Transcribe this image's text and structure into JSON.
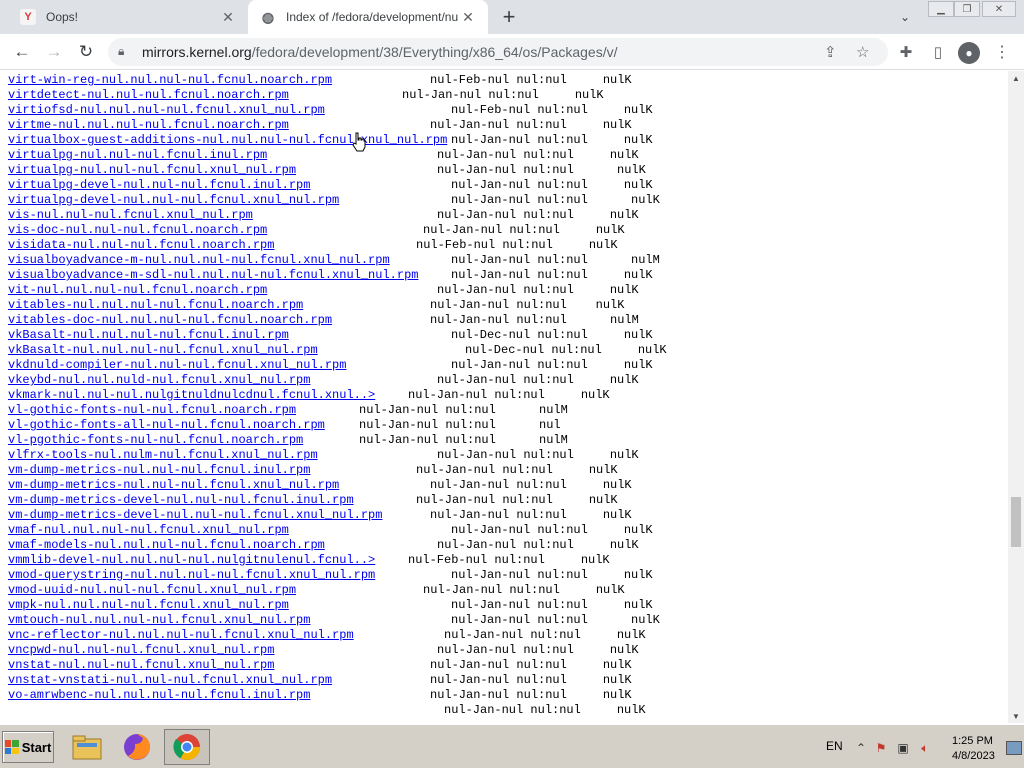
{
  "tabs": [
    {
      "title": "Oops!",
      "favicon": "Y"
    },
    {
      "title": "Index of /fedora/development/nul/E",
      "favicon": "globe-icon"
    }
  ],
  "toolbar": {
    "url_host": "mirrors.kernel.org",
    "url_path": "/fedora/development/38/Everything/x86_64/os/Packages/v/"
  },
  "listing": [
    {
      "name": "virt-win-reg-nul.nul.nul-nul.fcnul.noarch.rpm",
      "meta": "nul-Feb-nul nul:nul     nulK",
      "col": 430
    },
    {
      "name": "virtdetect-nul.nul-nul.fcnul.noarch.rpm",
      "meta": "nul-Jan-nul nul:nul     nulK",
      "col": 402
    },
    {
      "name": "virtiofsd-nul.nul.nul-nul.fcnul.xnul_nul.rpm",
      "meta": "nul-Feb-nul nul:nul     nulK",
      "col": 451
    },
    {
      "name": "virtme-nul.nul.nul-nul.fcnul.noarch.rpm",
      "meta": "nul-Jan-nul nul:nul     nulK",
      "col": 430
    },
    {
      "name": "virtualbox-guest-additions-nul.nul.nul-nul.fcnul.xnul_nul.rpm",
      "meta": "nul-Jan-nul nul:nul     nulK",
      "col": 451
    },
    {
      "name": "virtualpg-nul.nul-nul.fcnul.inul.rpm",
      "meta": "nul-Jan-nul nul:nul     nulK",
      "col": 437
    },
    {
      "name": "virtualpg-nul.nul-nul.fcnul.xnul_nul.rpm",
      "meta": "nul-Jan-nul nul:nul      nulK",
      "col": 437
    },
    {
      "name": "virtualpg-devel-nul.nul-nul.fcnul.inul.rpm",
      "meta": "nul-Jan-nul nul:nul     nulK",
      "col": 451
    },
    {
      "name": "virtualpg-devel-nul.nul-nul.fcnul.xnul_nul.rpm",
      "meta": "nul-Jan-nul nul:nul      nulK",
      "col": 451
    },
    {
      "name": "vis-nul.nul-nul.fcnul.xnul_nul.rpm",
      "meta": "nul-Jan-nul nul:nul     nulK",
      "col": 437
    },
    {
      "name": "vis-doc-nul.nul-nul.fcnul.noarch.rpm",
      "meta": "nul-Jan-nul nul:nul     nulK",
      "col": 423
    },
    {
      "name": "visidata-nul.nul-nul.fcnul.noarch.rpm",
      "meta": "nul-Feb-nul nul:nul     nulK",
      "col": 416
    },
    {
      "name": "visualboyadvance-m-nul.nul.nul-nul.fcnul.xnul_nul.rpm",
      "meta": "nul-Jan-nul nul:nul      nulM",
      "col": 451
    },
    {
      "name": "visualboyadvance-m-sdl-nul.nul.nul-nul.fcnul.xnul_nul.rpm",
      "meta": "nul-Jan-nul nul:nul     nulK",
      "col": 451
    },
    {
      "name": "vit-nul.nul.nul-nul.fcnul.noarch.rpm",
      "meta": "nul-Jan-nul nul:nul     nulK",
      "col": 437
    },
    {
      "name": "vitables-nul.nul.nul-nul.fcnul.noarch.rpm",
      "meta": "nul-Jan-nul nul:nul    nulK",
      "col": 430
    },
    {
      "name": "vitables-doc-nul.nul.nul-nul.fcnul.noarch.rpm",
      "meta": "nul-Jan-nul nul:nul      nulM",
      "col": 430
    },
    {
      "name": "vkBasalt-nul.nul.nul-nul.fcnul.inul.rpm",
      "meta": "nul-Dec-nul nul:nul     nulK",
      "col": 451
    },
    {
      "name": "vkBasalt-nul.nul.nul-nul.fcnul.xnul_nul.rpm",
      "meta": "nul-Dec-nul nul:nul     nulK",
      "col": 465
    },
    {
      "name": "vkdnuld-compiler-nul.nul-nul.fcnul.xnul_nul.rpm",
      "meta": "nul-Jan-nul nul:nul     nulK",
      "col": 451
    },
    {
      "name": "vkeybd-nul.nul.nuld-nul.fcnul.xnul_nul.rpm",
      "meta": "nul-Jan-nul nul:nul     nulK",
      "col": 437
    },
    {
      "name": "vkmark-nul.nul-nul.nulgitnuldnulcdnul.fcnul.xnul..>",
      "meta": "nul-Jan-nul nul:nul     nulK",
      "col": 408
    },
    {
      "name": "vl-gothic-fonts-nul-nul.fcnul.noarch.rpm",
      "meta": "nul-Jan-nul nul:nul      nulM",
      "col": 359
    },
    {
      "name": "vl-gothic-fonts-all-nul-nul.fcnul.noarch.rpm",
      "meta": "nul-Jan-nul nul:nul      nul",
      "col": 359
    },
    {
      "name": "vl-pgothic-fonts-nul-nul.fcnul.noarch.rpm",
      "meta": "nul-Jan-nul nul:nul      nulM",
      "col": 359
    },
    {
      "name": "vlfrx-tools-nul.nulm-nul.fcnul.xnul_nul.rpm",
      "meta": "nul-Jan-nul nul:nul     nulK",
      "col": 437
    },
    {
      "name": "vm-dump-metrics-nul.nul-nul.fcnul.inul.rpm",
      "meta": "nul-Jan-nul nul:nul     nulK",
      "col": 416
    },
    {
      "name": "vm-dump-metrics-nul.nul-nul.fcnul.xnul_nul.rpm",
      "meta": "nul-Jan-nul nul:nul     nulK",
      "col": 430
    },
    {
      "name": "vm-dump-metrics-devel-nul.nul-nul.fcnul.inul.rpm",
      "meta": "nul-Jan-nul nul:nul     nulK",
      "col": 416
    },
    {
      "name": "vm-dump-metrics-devel-nul.nul-nul.fcnul.xnul_nul.rpm",
      "meta": "nul-Jan-nul nul:nul     nulK",
      "col": 430
    },
    {
      "name": "vmaf-nul.nul.nul-nul.fcnul.xnul_nul.rpm",
      "meta": "nul-Jan-nul nul:nul     nulK",
      "col": 451
    },
    {
      "name": "vmaf-models-nul.nul.nul-nul.fcnul.noarch.rpm",
      "meta": "nul-Jan-nul nul:nul     nulK",
      "col": 437
    },
    {
      "name": "vmmlib-devel-nul.nul.nul-nul.nulgitnulenul.fcnul..>",
      "meta": "nul-Feb-nul nul:nul     nulK",
      "col": 408
    },
    {
      "name": "vmod-querystring-nul.nul.nul-nul.fcnul.xnul_nul.rpm",
      "meta": "nul-Jan-nul nul:nul     nulK",
      "col": 451
    },
    {
      "name": "vmod-uuid-nul.nul-nul.fcnul.xnul_nul.rpm",
      "meta": "nul-Jan-nul nul:nul     nulK",
      "col": 423
    },
    {
      "name": "vmpk-nul.nul.nul-nul.fcnul.xnul_nul.rpm",
      "meta": "nul-Jan-nul nul:nul     nulK",
      "col": 451
    },
    {
      "name": "vmtouch-nul.nul.nul-nul.fcnul.xnul_nul.rpm",
      "meta": "nul-Jan-nul nul:nul      nulK",
      "col": 451
    },
    {
      "name": "vnc-reflector-nul.nul.nul-nul.fcnul.xnul_nul.rpm",
      "meta": "nul-Jan-nul nul:nul     nulK",
      "col": 444
    },
    {
      "name": "vncpwd-nul.nul-nul.fcnul.xnul_nul.rpm",
      "meta": "nul-Jan-nul nul:nul     nulK",
      "col": 437
    },
    {
      "name": "vnstat-nul.nul-nul.fcnul.xnul_nul.rpm",
      "meta": "nul-Jan-nul nul:nul     nulK",
      "col": 430
    },
    {
      "name": "vnstat-vnstati-nul.nul-nul.fcnul.xnul_nul.rpm",
      "meta": "nul-Jan-nul nul:nul     nulK",
      "col": 430
    },
    {
      "name": "vo-amrwbenc-nul.nul.nul-nul.fcnul.inul.rpm",
      "meta": "nul-Jan-nul nul:nul     nulK",
      "col": 430
    },
    {
      "name": "",
      "meta": "nul-Jan-nul nul:nul     nulK",
      "col": 444
    }
  ],
  "taskbar": {
    "start_label": "Start",
    "language": "EN",
    "time": "1:25 PM",
    "date": "4/8/2023"
  }
}
